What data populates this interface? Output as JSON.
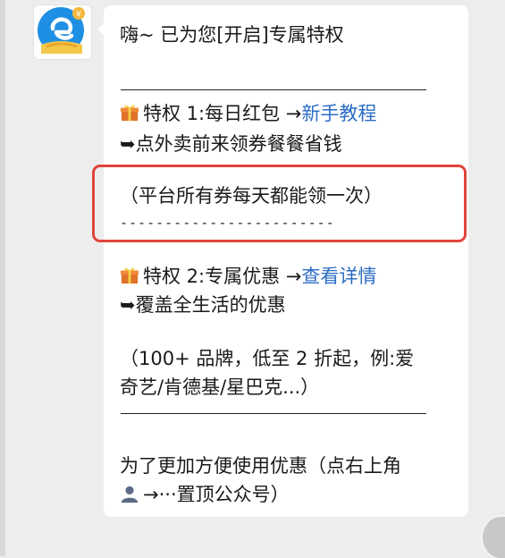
{
  "message": {
    "greeting": "嗨~ 已为您[开启]专属特权",
    "privilege1": {
      "title": "特权 1:每日红包 →",
      "link": "新手教程",
      "desc": "➥点外卖前来领券餐餐省钱",
      "note": "（平台所有券每天都能领一次）",
      "dashes": "------------------------"
    },
    "privilege2": {
      "title": "特权 2:专属优惠 →",
      "link": "查看详情",
      "desc": "➥覆盖全生活的优惠",
      "note_line1": "（100+ 品牌，低至 2 折起，例:爱",
      "note_line2": "奇艺/肯德基/星巴克...）"
    },
    "footer_line1": "为了更加方便使用优惠（点右上角",
    "footer_line2": "→···置顶公众号）"
  },
  "icons": {
    "avatar": "eleme-logo",
    "gift": "gift-icon",
    "person": "person-icon"
  },
  "colors": {
    "link": "#2b6cc4",
    "highlight_box": "#e0453a",
    "background": "#ededed"
  }
}
